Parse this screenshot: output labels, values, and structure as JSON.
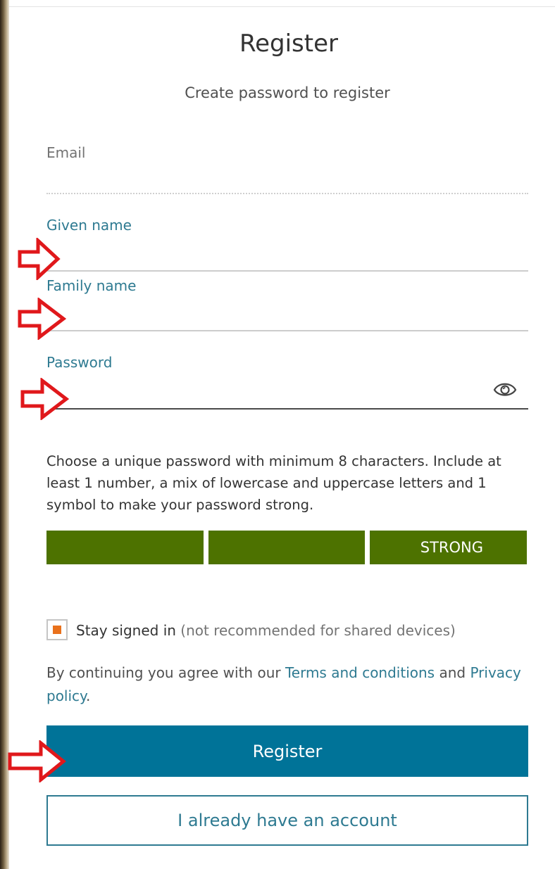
{
  "header": {
    "title": "Register",
    "subtitle": "Create password to register"
  },
  "form": {
    "email": {
      "label": "Email",
      "value": ""
    },
    "given_name": {
      "label": "Given name",
      "value": ""
    },
    "family_name": {
      "label": "Family name",
      "value": ""
    },
    "password": {
      "label": "Password",
      "value": "",
      "toggle_icon": "eye-icon"
    }
  },
  "password_hint": "Choose a unique password with minimum 8 characters. Include at least 1 number, a mix of lowercase and uppercase letters and 1 symbol to make your password strong.",
  "strength_meter": {
    "label": "STRONG",
    "segments_filled": 3,
    "segments_total": 3,
    "color": "#4d7200"
  },
  "stay_signed_in": {
    "label": "Stay signed in",
    "note": "(not recommended for shared devices)",
    "checked": true,
    "accent": "#e9711c"
  },
  "terms": {
    "prefix": "By continuing you agree with our",
    "terms_link": "Terms and conditions",
    "conjunction": "and",
    "privacy_link": "Privacy policy",
    "suffix": "."
  },
  "actions": {
    "register_label": "Register",
    "signin_label": "I already have an account"
  },
  "annotations": {
    "icon": "arrow-right-outline-icon",
    "color": "#e0181b"
  },
  "colors": {
    "primary": "#007398",
    "link": "#2e7a91"
  }
}
